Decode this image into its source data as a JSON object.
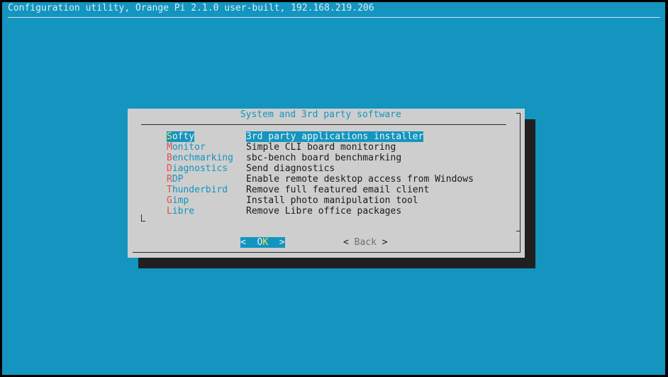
{
  "backtitle": "Configuration utility, Orange Pi 2.1.0 user-built, 192.168.219.206",
  "dialog": {
    "title": " System and 3rd party software "
  },
  "menu": {
    "items": [
      {
        "hotkey": "S",
        "rest": "ofty",
        "desc": "3rd party applications installer",
        "selected": true
      },
      {
        "hotkey": "M",
        "rest": "onitor",
        "desc": "Simple CLI board monitoring",
        "selected": false
      },
      {
        "hotkey": "B",
        "rest": "enchmarking",
        "desc": "sbc-bench board benchmarking",
        "selected": false
      },
      {
        "hotkey": "D",
        "rest": "iagnostics",
        "desc": "Send diagnostics",
        "selected": false
      },
      {
        "hotkey": "R",
        "rest": "DP",
        "desc": "Enable remote desktop access from Windows",
        "selected": false
      },
      {
        "hotkey": "T",
        "rest": "hunderbird",
        "desc": "Remove full featured email client",
        "selected": false
      },
      {
        "hotkey": "G",
        "rest": "imp",
        "desc": "Install photo manipulation tool",
        "selected": false
      },
      {
        "hotkey": "L",
        "rest": "ibre",
        "desc": "Remove Libre office packages",
        "selected": false
      }
    ]
  },
  "buttons": {
    "ok": {
      "left": "<  ",
      "pre": "O",
      "hot": "K",
      "right": "  >"
    },
    "back": {
      "left": "< ",
      "label": "Back",
      "right": " >"
    }
  },
  "colors": {
    "background": "#1395bf",
    "dialog": "#cecece",
    "shadow": "#202020",
    "hotkey": "#e05050",
    "selected_hotkey": "#f4e94a"
  }
}
